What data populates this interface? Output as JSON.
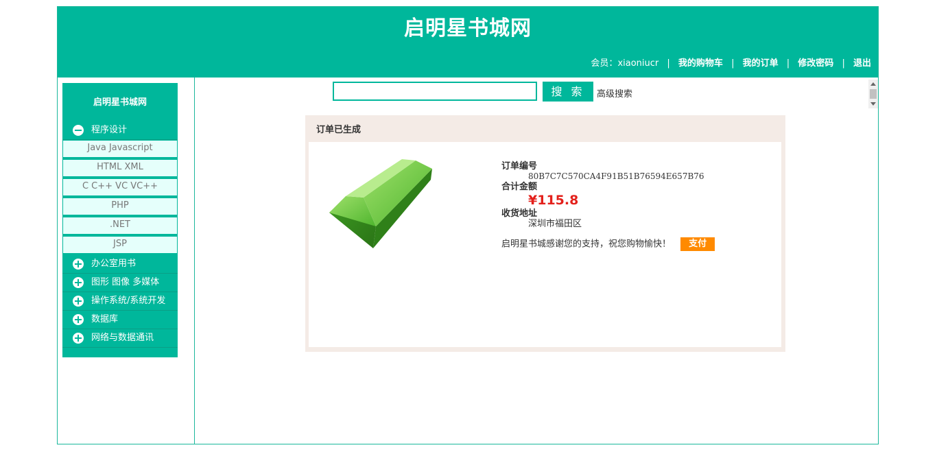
{
  "header": {
    "site_title": "启明星书城网",
    "member_label": "会员：",
    "username": "xiaoniucr",
    "separator": "|",
    "links": [
      "我的购物车",
      "我的订单",
      "修改密码",
      "退出"
    ]
  },
  "sidebar": {
    "title": "启明星书城网",
    "categories": [
      {
        "label": "程序设计",
        "expanded": true,
        "icon": "minus-circle-icon",
        "items": [
          "Java Javascript",
          "HTML XML",
          "C C++ VC VC++",
          "PHP",
          ".NET",
          "JSP"
        ]
      },
      {
        "label": "办公室用书",
        "expanded": false,
        "icon": "plus-circle-icon"
      },
      {
        "label": "图形 图像 多媒体",
        "expanded": false,
        "icon": "plus-circle-icon"
      },
      {
        "label": "操作系统/系统开发",
        "expanded": false,
        "icon": "plus-circle-icon"
      },
      {
        "label": "数据库",
        "expanded": false,
        "icon": "plus-circle-icon"
      },
      {
        "label": "网络与数据通讯",
        "expanded": false,
        "icon": "plus-circle-icon"
      }
    ]
  },
  "search": {
    "value": "",
    "button_label": "搜 索",
    "advanced_label": "高级搜索"
  },
  "order": {
    "heading": "订单已生成",
    "number_label": "订单编号",
    "number_value": "80B7C7C570CA4F91B51B76594E657B76",
    "total_label": "合计金额",
    "total_value": "¥115.8",
    "address_label": "收货地址",
    "address_value": "深圳市福田区",
    "thanks_text": "启明星书城感谢您的支持，祝您购物愉快！",
    "pay_button": "支付"
  },
  "colors": {
    "brand": "#00b79b",
    "amount": "#e3201b",
    "pay": "#ff8a00",
    "panel": "#f4ebe6"
  }
}
